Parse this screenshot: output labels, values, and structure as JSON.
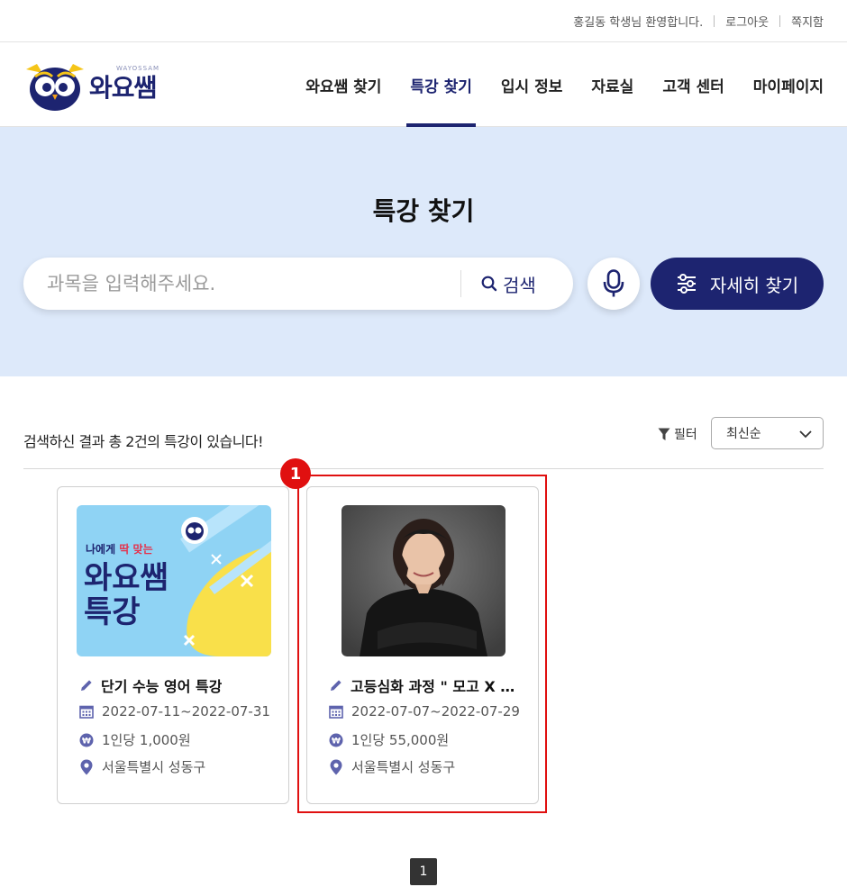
{
  "utility": {
    "welcome": "홍길동 학생님 환영합니다.",
    "logout": "로그아웃",
    "messages": "쪽지함"
  },
  "logo": {
    "small": "WAYOSSAM",
    "big": "와요쌤"
  },
  "nav": [
    {
      "label": "와요쌤 찾기",
      "active": false
    },
    {
      "label": "특강 찾기",
      "active": true
    },
    {
      "label": "입시 정보",
      "active": false
    },
    {
      "label": "자료실",
      "active": false
    },
    {
      "label": "고객 센터",
      "active": false
    },
    {
      "label": "마이페이지",
      "active": false
    }
  ],
  "hero": {
    "title": "특강 찾기",
    "search_placeholder": "과목을 입력해주세요.",
    "search_button": "검색",
    "mic_icon": "microphone-icon",
    "detail_button": "자세히 찾기"
  },
  "results": {
    "count_text": "검색하신 결과 총 2건의 특강이 있습니다!",
    "filter_label": "필터",
    "sort_value": "최신순"
  },
  "promo": {
    "line1_a": "나에게 ",
    "line1_b": "딱 맞는",
    "line2": "와요쌤",
    "line3": "특강"
  },
  "cards": [
    {
      "title": "단기 수능 영어 특강",
      "date": "2022-07-11~2022-07-31",
      "price": "1인당 1,000원",
      "location": "서울특별시 성동구"
    },
    {
      "title": "고등심화 과정 \" 모고 X 수능 \"",
      "date": "2022-07-07~2022-07-29",
      "price": "1인당 55,000원",
      "location": "서울특별시 성동구"
    }
  ],
  "annotation": {
    "badge": "1"
  },
  "pagination": {
    "current": "1"
  },
  "colors": {
    "brand": "#1d2470",
    "hero_bg": "#dde9fa",
    "highlight": "#e01010",
    "icon": "#5e63ad"
  }
}
